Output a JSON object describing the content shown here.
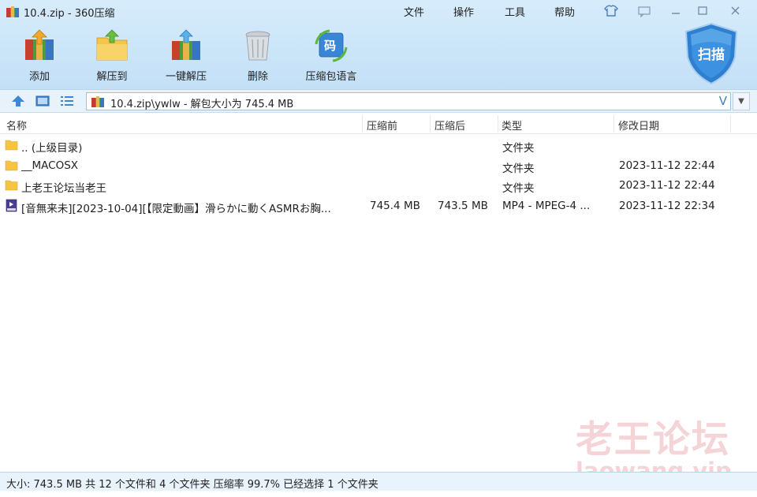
{
  "window": {
    "title": "10.4.zip - 360压缩",
    "menu": [
      "文件",
      "操作",
      "工具",
      "帮助"
    ]
  },
  "toolbar": [
    {
      "label": "添加",
      "icon": "add-archive-icon"
    },
    {
      "label": "解压到",
      "icon": "extract-to-icon"
    },
    {
      "label": "一键解压",
      "icon": "one-click-extract-icon"
    },
    {
      "label": "删除",
      "icon": "delete-trash-icon"
    },
    {
      "label": "压缩包语言",
      "icon": "archive-language-icon",
      "badge": "码"
    }
  ],
  "scan_button": {
    "label": "扫描",
    "icon": "shield-scan-icon"
  },
  "address": {
    "path": "10.4.zip\\ywlw - 解包大小为 745.4 MB",
    "suffix": "V"
  },
  "columns": {
    "name": "名称",
    "compressed": "压缩前",
    "size": "压缩后",
    "type": "类型",
    "modified": "修改日期"
  },
  "files": [
    {
      "icon": "folder-icon",
      "name": ".. (上级目录)",
      "compressed": "",
      "size": "",
      "type": "文件夹",
      "modified": ""
    },
    {
      "icon": "folder-icon",
      "name": "__MACOSX",
      "compressed": "",
      "size": "",
      "type": "文件夹",
      "modified": "2023-11-12 22:44"
    },
    {
      "icon": "folder-icon",
      "name": "上老王论坛当老王",
      "compressed": "",
      "size": "",
      "type": "文件夹",
      "modified": "2023-11-12 22:44"
    },
    {
      "icon": "mp4-file-icon",
      "name": "[音無来未][2023-10-04][【限定動画】滑らかに動くASMRお胸...",
      "compressed": "745.4 MB",
      "size": "743.5 MB",
      "type": "MP4 - MPEG-4 ...",
      "modified": "2023-11-12 22:34"
    }
  ],
  "watermark": {
    "line1": "老王论坛",
    "line2": "laowang.vip"
  },
  "status": "大小: 743.5 MB 共 12 个文件和 4 个文件夹 压缩率 99.7% 已经选择 1 个文件夹",
  "colors": {
    "toolbar_bg": "#c9e3f8",
    "addr_border": "#9fc2e2",
    "shield": "#2f7fd0",
    "folder": "#f6c443"
  }
}
